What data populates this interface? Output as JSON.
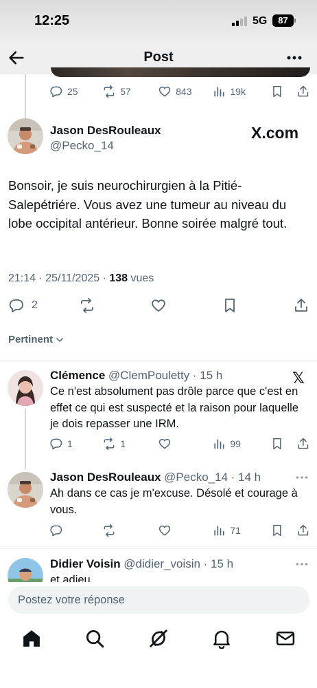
{
  "status_bar": {
    "time": "12:25",
    "network": "5G",
    "battery": "87"
  },
  "header": {
    "title": "Post"
  },
  "previous_post": {
    "replies": "25",
    "reposts": "57",
    "likes": "843",
    "views": "19k"
  },
  "main_post": {
    "author_name": "Jason DesRouleaux",
    "author_handle": "@Pecko_14",
    "watermark": "X.com",
    "text": "Bonsoir, je suis neurochirurgien à la Pitié-Salepétriére. Vous avez une tumeur au niveau du lobe occipital antérieur. Bonne soirée malgré tout.",
    "timestamp": "21:14 · 25/11/2025 · ",
    "views_count": "138",
    "views_label": " vues",
    "replies": "2"
  },
  "sort_label": "Pertinent",
  "replies": [
    {
      "name": "Clémence",
      "handle": "@ClemPouletty",
      "time": "· 15 h",
      "text": "Ce n'est absolument pas drôle parce que c'est en effet ce qui est suspecté et la raison pour laquelle je dois repasser une IRM.",
      "replies": "1",
      "reposts": "1",
      "likes": "",
      "views": "99"
    },
    {
      "name": "Jason DesRouleaux",
      "handle": "@Pecko_14",
      "time": "· 14 h",
      "text": "Ah dans ce cas je m'excuse. Désolé et courage à vous.",
      "replies": "",
      "reposts": "",
      "likes": "",
      "views": "71"
    },
    {
      "name": "Didier Voisin",
      "handle": "@didier_voisin",
      "time": "· 15 h",
      "text": "et adieu"
    }
  ],
  "composer": {
    "placeholder": "Postez votre réponse"
  },
  "colors": {
    "text": "#0f1419",
    "secondary": "#536471",
    "divider": "#eff3f4"
  },
  "tabs": [
    "home-icon",
    "search-icon",
    "grok-icon",
    "notifications-icon",
    "messages-icon"
  ]
}
